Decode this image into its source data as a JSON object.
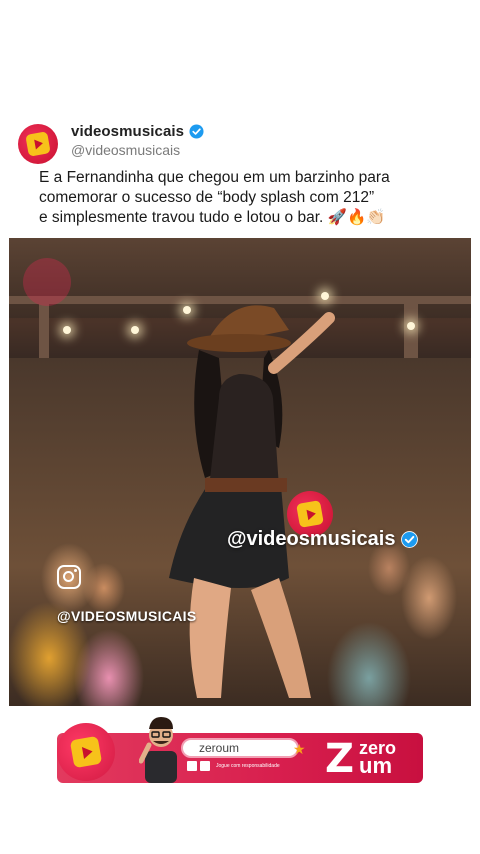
{
  "post": {
    "display_name": "videosmusicais",
    "handle": "@videosmusicais",
    "caption": "E a Fernandinha que chegou em um barzinho para\ncomemorar o sucesso de “body splash com 212”\ne simplesmente travou tudo e lotou o bar. 🚀🔥👏🏻",
    "avatar_icon": "music-note-logo",
    "verified_icon": "verified-badge-icon"
  },
  "video": {
    "watermark_handle": "@videosmusicais",
    "instagram_handle": "@VIDEOSMUSICAIS",
    "instagram_icon": "instagram-icon"
  },
  "ad": {
    "pill_text": "zeroum",
    "fine_print": "Jogue com responsabilidade",
    "brand_zero": "zero",
    "brand_um": "um",
    "brand_z": "Z"
  },
  "colors": {
    "brand_red": "#d81f4e",
    "logo_yellow": "#f7c21a",
    "verified_blue": "#1d9bf0"
  }
}
